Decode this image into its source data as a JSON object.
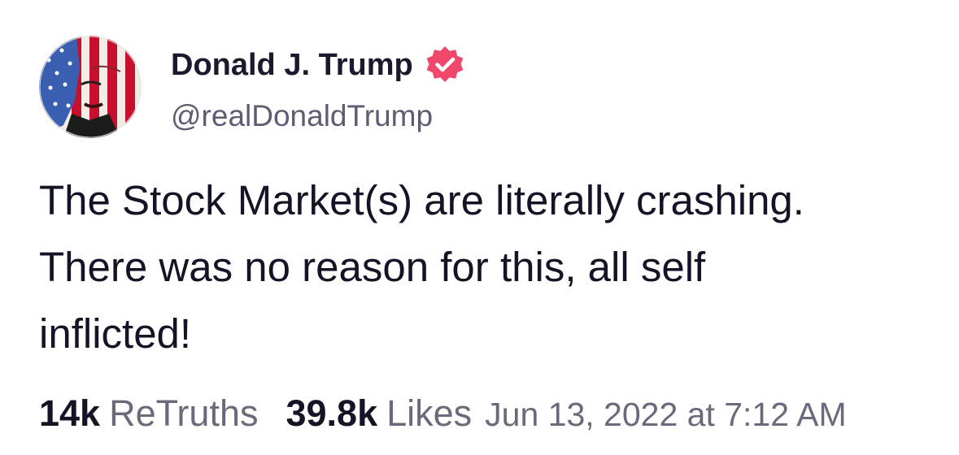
{
  "post": {
    "author": {
      "display_name": "Donald J. Trump",
      "handle": "@realDonaldTrump",
      "avatar_icon": "portrait-flag-avatar",
      "verified_icon": "verified-badge-icon"
    },
    "body_lines": [
      "The Stock Market(s) are literally crashing.",
      "There was no reason for this, all self",
      "inflicted!"
    ],
    "stats": {
      "retruths_count": "14k",
      "retruths_label": "ReTruths",
      "likes_count": "39.8k",
      "likes_label": "Likes"
    },
    "timestamp": "Jun 13, 2022 at 7:12 AM"
  },
  "colors": {
    "text_primary": "#141426",
    "text_secondary": "#6a6a7c",
    "verified_badge": "#f0476d",
    "flag_red": "#c8102e",
    "flag_blue": "#3a5fb0"
  }
}
